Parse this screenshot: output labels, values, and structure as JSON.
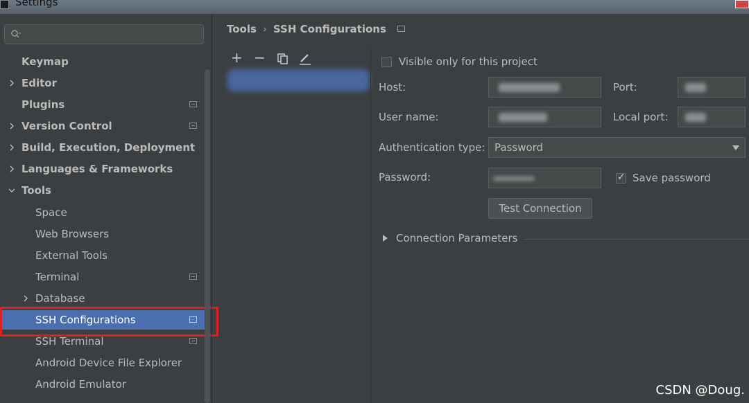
{
  "window": {
    "title": "Settings"
  },
  "sidebar": {
    "search": {
      "placeholder": "Q-"
    },
    "items": [
      {
        "label": "Keymap"
      },
      {
        "label": "Editor"
      },
      {
        "label": "Plugins"
      },
      {
        "label": "Version Control"
      },
      {
        "label": "Build, Execution, Deployment"
      },
      {
        "label": "Languages & Frameworks"
      },
      {
        "label": "Tools"
      },
      {
        "label": "Space"
      },
      {
        "label": "Web Browsers"
      },
      {
        "label": "External Tools"
      },
      {
        "label": "Terminal"
      },
      {
        "label": "Database"
      },
      {
        "label": "SSH Configurations"
      },
      {
        "label": "SSH Terminal"
      },
      {
        "label": "Android Device File Explorer"
      },
      {
        "label": "Android Emulator"
      }
    ]
  },
  "breadcrumb": {
    "parent": "Tools",
    "separator": "›",
    "current": "SSH Configurations"
  },
  "toolbar": {
    "add": "+",
    "remove": "−"
  },
  "form": {
    "visible_only_label": "Visible only for this project",
    "host_label": "Host:",
    "port_label": "Port:",
    "username_label": "User name:",
    "local_port_label": "Local port:",
    "auth_type_label": "Authentication type:",
    "auth_type_value": "Password",
    "password_label": "Password:",
    "save_password_label": "Save password",
    "test_connection_label": "Test Connection",
    "connection_params_label": "Connection Parameters"
  },
  "watermark": "CSDN @Doug.",
  "colors": {
    "selection": "#4b6eaf",
    "highlight_border": "#e02020",
    "background": "#3c3f41"
  }
}
